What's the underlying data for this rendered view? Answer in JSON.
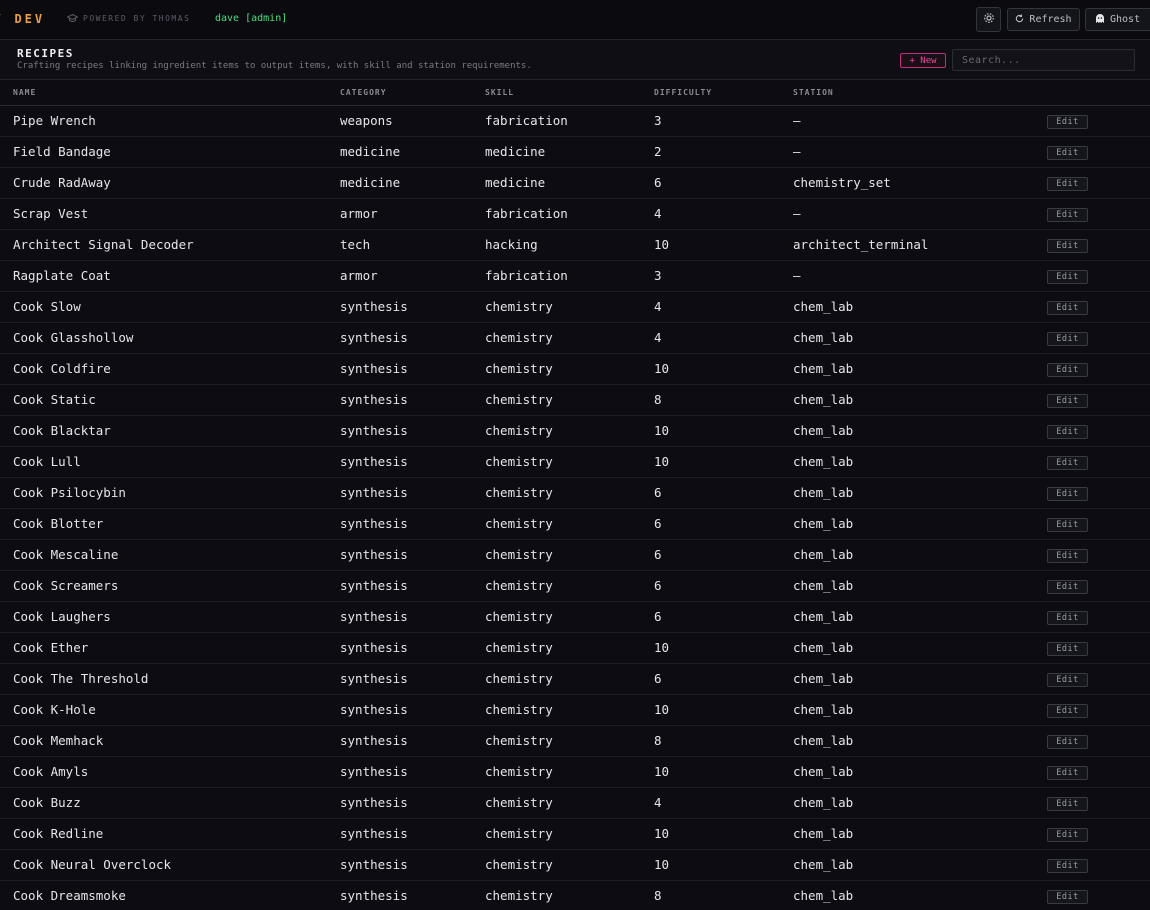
{
  "app": {
    "brand": "/ DEV",
    "powered_by": "POWERED BY THOMAS",
    "user": "dave [admin]",
    "refresh_label": "Refresh",
    "ghost_label": "Ghost"
  },
  "section": {
    "title": "RECIPES",
    "description": "Crafting recipes linking ingredient items to output items, with skill and station requirements.",
    "new_label": "+ New",
    "search_placeholder": "Search..."
  },
  "table": {
    "columns": [
      "NAME",
      "CATEGORY",
      "SKILL",
      "DIFFICULTY",
      "STATION",
      ""
    ],
    "edit_label": "Edit",
    "rows": [
      {
        "name": "Pipe Wrench",
        "category": "weapons",
        "skill": "fabrication",
        "difficulty": "3",
        "station": "—"
      },
      {
        "name": "Field Bandage",
        "category": "medicine",
        "skill": "medicine",
        "difficulty": "2",
        "station": "—"
      },
      {
        "name": "Crude RadAway",
        "category": "medicine",
        "skill": "medicine",
        "difficulty": "6",
        "station": "chemistry_set"
      },
      {
        "name": "Scrap Vest",
        "category": "armor",
        "skill": "fabrication",
        "difficulty": "4",
        "station": "—"
      },
      {
        "name": "Architect Signal Decoder",
        "category": "tech",
        "skill": "hacking",
        "difficulty": "10",
        "station": "architect_terminal"
      },
      {
        "name": "Ragplate Coat",
        "category": "armor",
        "skill": "fabrication",
        "difficulty": "3",
        "station": "—"
      },
      {
        "name": "Cook Slow",
        "category": "synthesis",
        "skill": "chemistry",
        "difficulty": "4",
        "station": "chem_lab"
      },
      {
        "name": "Cook Glasshollow",
        "category": "synthesis",
        "skill": "chemistry",
        "difficulty": "4",
        "station": "chem_lab"
      },
      {
        "name": "Cook Coldfire",
        "category": "synthesis",
        "skill": "chemistry",
        "difficulty": "10",
        "station": "chem_lab"
      },
      {
        "name": "Cook Static",
        "category": "synthesis",
        "skill": "chemistry",
        "difficulty": "8",
        "station": "chem_lab"
      },
      {
        "name": "Cook Blacktar",
        "category": "synthesis",
        "skill": "chemistry",
        "difficulty": "10",
        "station": "chem_lab"
      },
      {
        "name": "Cook Lull",
        "category": "synthesis",
        "skill": "chemistry",
        "difficulty": "10",
        "station": "chem_lab"
      },
      {
        "name": "Cook Psilocybin",
        "category": "synthesis",
        "skill": "chemistry",
        "difficulty": "6",
        "station": "chem_lab"
      },
      {
        "name": "Cook Blotter",
        "category": "synthesis",
        "skill": "chemistry",
        "difficulty": "6",
        "station": "chem_lab"
      },
      {
        "name": "Cook Mescaline",
        "category": "synthesis",
        "skill": "chemistry",
        "difficulty": "6",
        "station": "chem_lab"
      },
      {
        "name": "Cook Screamers",
        "category": "synthesis",
        "skill": "chemistry",
        "difficulty": "6",
        "station": "chem_lab"
      },
      {
        "name": "Cook Laughers",
        "category": "synthesis",
        "skill": "chemistry",
        "difficulty": "6",
        "station": "chem_lab"
      },
      {
        "name": "Cook Ether",
        "category": "synthesis",
        "skill": "chemistry",
        "difficulty": "10",
        "station": "chem_lab"
      },
      {
        "name": "Cook The Threshold",
        "category": "synthesis",
        "skill": "chemistry",
        "difficulty": "6",
        "station": "chem_lab"
      },
      {
        "name": "Cook K-Hole",
        "category": "synthesis",
        "skill": "chemistry",
        "difficulty": "10",
        "station": "chem_lab"
      },
      {
        "name": "Cook Memhack",
        "category": "synthesis",
        "skill": "chemistry",
        "difficulty": "8",
        "station": "chem_lab"
      },
      {
        "name": "Cook Amyls",
        "category": "synthesis",
        "skill": "chemistry",
        "difficulty": "10",
        "station": "chem_lab"
      },
      {
        "name": "Cook Buzz",
        "category": "synthesis",
        "skill": "chemistry",
        "difficulty": "4",
        "station": "chem_lab"
      },
      {
        "name": "Cook Redline",
        "category": "synthesis",
        "skill": "chemistry",
        "difficulty": "10",
        "station": "chem_lab"
      },
      {
        "name": "Cook Neural Overclock",
        "category": "synthesis",
        "skill": "chemistry",
        "difficulty": "10",
        "station": "chem_lab"
      },
      {
        "name": "Cook Dreamsmoke",
        "category": "synthesis",
        "skill": "chemistry",
        "difficulty": "8",
        "station": "chem_lab"
      }
    ]
  },
  "colors": {
    "brand": "#e8a040",
    "user": "#4ade80",
    "new_accent": "#ec4899",
    "background": "#0c0c12"
  },
  "icons": {
    "settings": "gear-icon",
    "refresh": "refresh-icon",
    "ghost": "ghost-icon",
    "powered": "graduation-cap-icon"
  }
}
